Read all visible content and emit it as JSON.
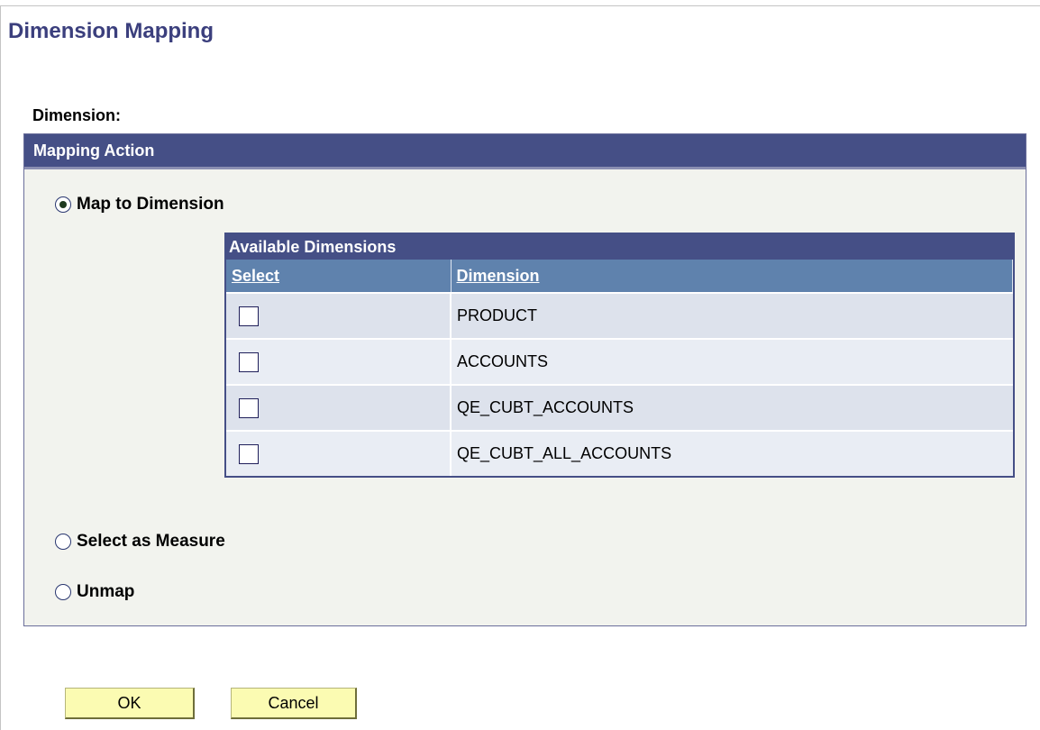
{
  "page": {
    "title": "Dimension Mapping"
  },
  "dimension": {
    "label": "Dimension:"
  },
  "mapping_action": {
    "header": "Mapping Action",
    "options": [
      {
        "label": "Map to Dimension",
        "checked": true
      },
      {
        "label": "Select as Measure",
        "checked": false
      },
      {
        "label": "Unmap",
        "checked": false
      }
    ]
  },
  "available_dimensions": {
    "title": "Available Dimensions",
    "columns": {
      "select": "Select",
      "dimension": "Dimension"
    },
    "rows": [
      {
        "name": "PRODUCT",
        "selected": false
      },
      {
        "name": "ACCOUNTS",
        "selected": false
      },
      {
        "name": "QE_CUBT_ACCOUNTS",
        "selected": false
      },
      {
        "name": "QE_CUBT_ALL_ACCOUNTS",
        "selected": false
      }
    ]
  },
  "buttons": {
    "ok": "OK",
    "cancel": "Cancel"
  }
}
